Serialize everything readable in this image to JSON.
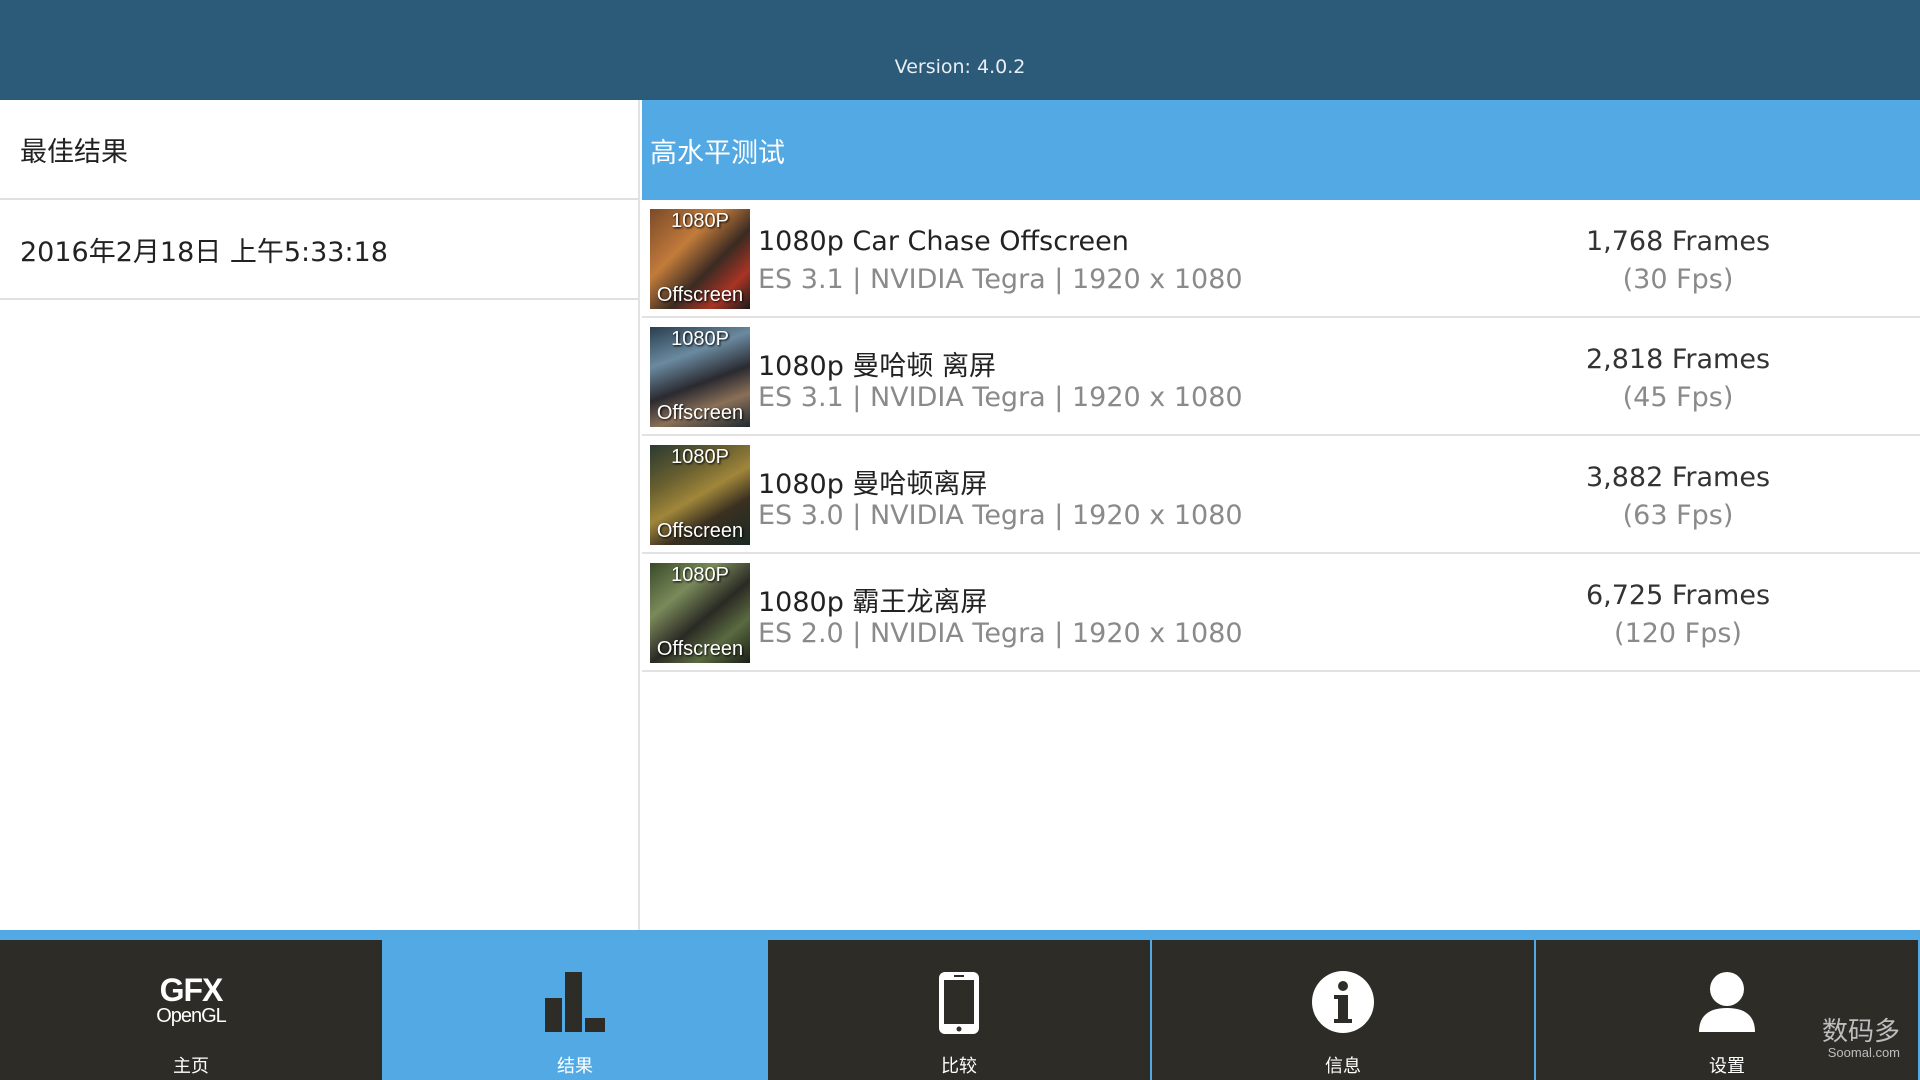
{
  "header": {
    "version": "Version: 4.0.2"
  },
  "left": {
    "title": "最佳结果",
    "timestamp": "2016年2月18日 上午5:33:18"
  },
  "main": {
    "section_title": "高水平测试",
    "results": [
      {
        "thumb_top": "1080P",
        "thumb_bottom": "Offscreen",
        "title": "1080p Car Chase Offscreen",
        "sub": "ES 3.1 | NVIDIA Tegra | 1920 x 1080",
        "score": "1,768 Frames",
        "fps": "(30 Fps)"
      },
      {
        "thumb_top": "1080P",
        "thumb_bottom": "Offscreen",
        "title": "1080p 曼哈顿 离屏",
        "sub": "ES 3.1 | NVIDIA Tegra | 1920 x 1080",
        "score": "2,818 Frames",
        "fps": "(45 Fps)"
      },
      {
        "thumb_top": "1080P",
        "thumb_bottom": "Offscreen",
        "title": "1080p 曼哈顿离屏",
        "sub": "ES 3.0 | NVIDIA Tegra | 1920 x 1080",
        "score": "3,882 Frames",
        "fps": "(63 Fps)"
      },
      {
        "thumb_top": "1080P",
        "thumb_bottom": "Offscreen",
        "title": "1080p 霸王龙离屏",
        "sub": "ES 2.0 | NVIDIA Tegra | 1920 x 1080",
        "score": "6,725 Frames",
        "fps": "(120 Fps)"
      }
    ]
  },
  "nav": {
    "logo_line1": "GFX",
    "logo_line2": "OpenGL",
    "items": [
      {
        "label": "主页",
        "icon": "gfx-logo-icon"
      },
      {
        "label": "结果",
        "icon": "bar-chart-icon"
      },
      {
        "label": "比较",
        "icon": "phone-icon"
      },
      {
        "label": "信息",
        "icon": "info-icon"
      },
      {
        "label": "设置",
        "icon": "user-icon"
      }
    ]
  },
  "watermark": {
    "line1": "数码多",
    "line2": "Soomal.com"
  },
  "colors": {
    "topbar": "#2c5a79",
    "accent": "#52a9e3",
    "nav_bg": "#2e2c27"
  }
}
